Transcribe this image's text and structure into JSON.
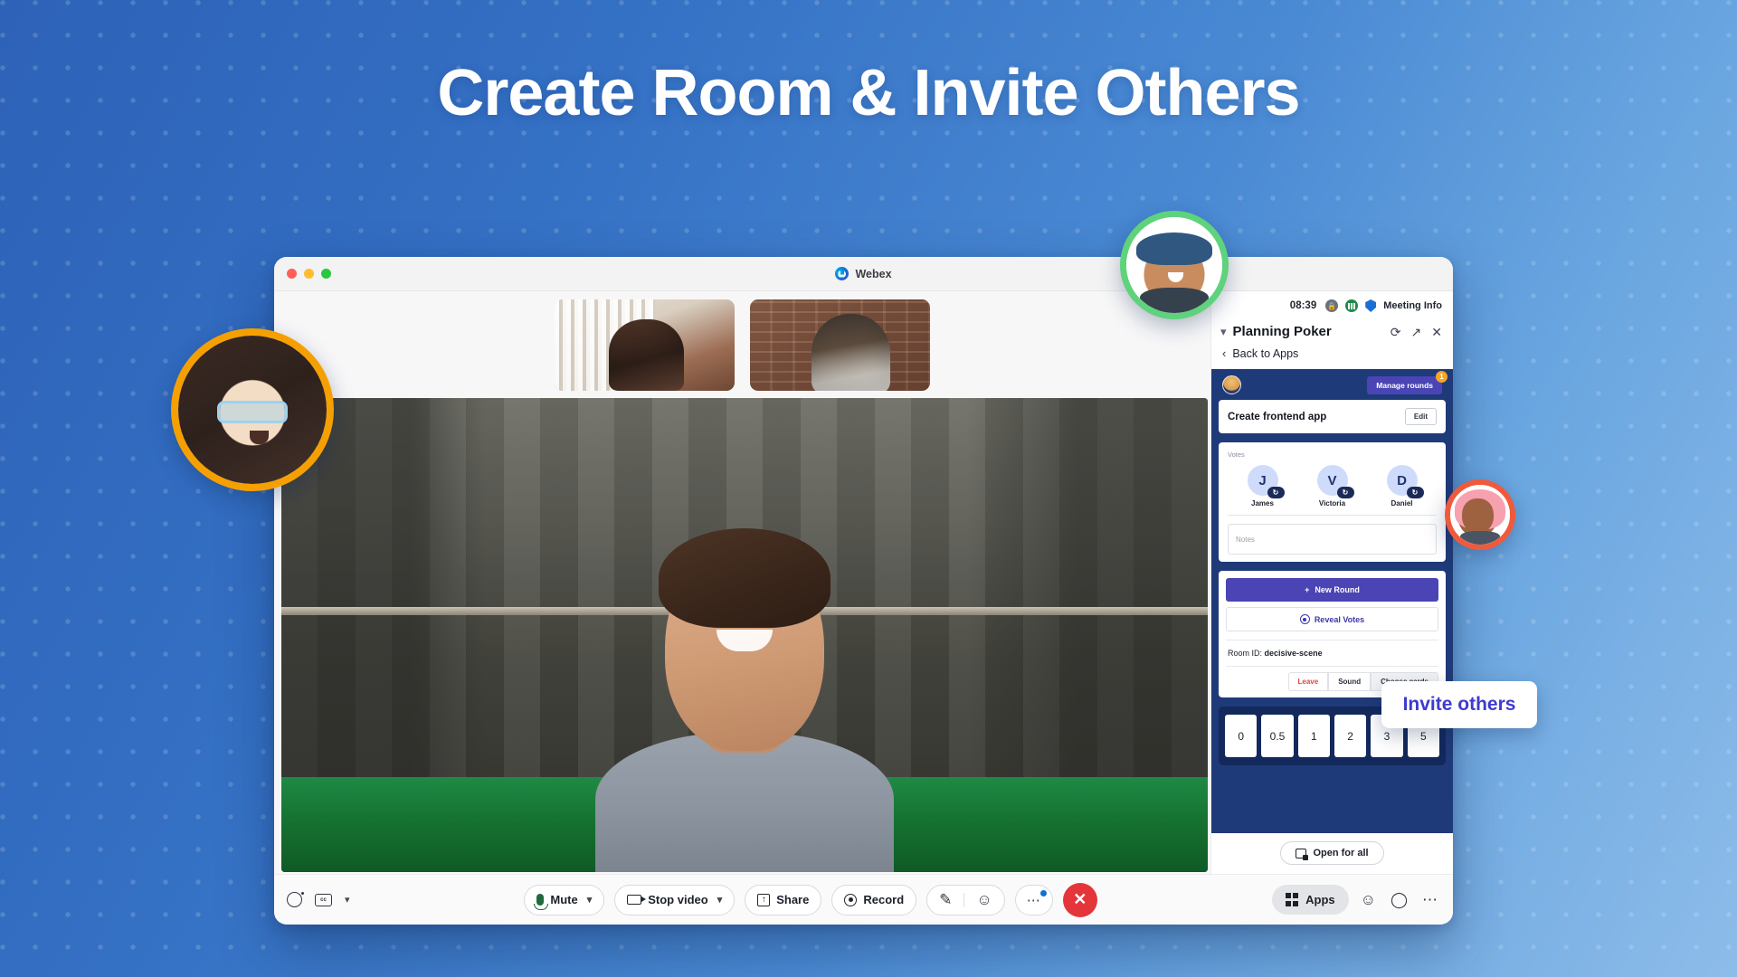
{
  "hero": {
    "title": "Create Room & Invite Others"
  },
  "window": {
    "app_name": "Webex",
    "traffic_lights": [
      "close-red",
      "minimize-yellow",
      "maximize-green"
    ]
  },
  "meeting_info": {
    "time": "08:39",
    "lock_icon": "lock-icon",
    "network_icon": "network-quality-icon",
    "shield_icon": "shield-icon",
    "label": "Meeting Info"
  },
  "panel": {
    "title": "Planning Poker",
    "collapse_icon": "chevron-down-icon",
    "refresh_icon": "refresh-icon",
    "popout_icon": "open-external-icon",
    "close_icon": "close-icon",
    "back_label": "Back to Apps",
    "back_icon": "chevron-left-icon"
  },
  "poker": {
    "avatar_icon": "user-avatar-icon",
    "manage_rounds_label": "Manage rounds",
    "manage_rounds_badge": "1",
    "topic": "Create frontend app",
    "edit_label": "Edit",
    "votes_label": "Votes",
    "voters": [
      {
        "initial": "J",
        "name": "James",
        "badge_icon": "pending-icon"
      },
      {
        "initial": "V",
        "name": "Victoria",
        "badge_icon": "pending-icon"
      },
      {
        "initial": "D",
        "name": "Daniel",
        "badge_icon": "pending-icon"
      }
    ],
    "notes_placeholder": "Notes",
    "new_round_label": "New Round",
    "new_round_icon": "plus-icon",
    "reveal_votes_label": "Reveal Votes",
    "reveal_icon": "eye-icon",
    "room_id_prefix": "Room ID:",
    "room_id": "decisive-scene",
    "leave_label": "Leave",
    "sound_label": "Sound",
    "choose_cards_label": "Choose cards",
    "deck": [
      "0",
      "0.5",
      "1",
      "2",
      "3",
      "5"
    ],
    "open_for_all_label": "Open for all",
    "open_for_all_icon": "open-for-all-icon"
  },
  "tooltip": {
    "label": "Invite others"
  },
  "controls": {
    "record_ring_icon": "recording-status-icon",
    "cc_icon": "closed-captions-icon",
    "cc_text": "cc",
    "cc_caret_icon": "chevron-down-icon",
    "mute_label": "Mute",
    "mute_icon": "microphone-icon",
    "mute_caret_icon": "chevron-down-icon",
    "video_label": "Stop video",
    "video_icon": "camera-icon",
    "video_caret_icon": "chevron-down-icon",
    "share_label": "Share",
    "share_icon": "share-screen-icon",
    "record_label": "Record",
    "record_icon": "record-icon",
    "annotate_icon": "annotate-icon",
    "reactions_icon": "reactions-icon",
    "more_icon": "more-options-icon",
    "end_icon": "end-call-icon",
    "apps_label": "Apps",
    "apps_icon": "apps-grid-icon",
    "participants_icon": "participants-icon",
    "chat_icon": "chat-icon",
    "rail_more_icon": "more-options-icon"
  },
  "floating_avatars": [
    {
      "name": "avatar-woman-sunglasses",
      "ring_color": "#f5a000"
    },
    {
      "name": "avatar-man-hat",
      "ring_color": "#5fd27c"
    },
    {
      "name": "avatar-woman-pink-hair",
      "ring_color": "#f05a3c"
    }
  ],
  "colors": {
    "background_top": "#2d62b8",
    "background_bottom": "#8dbce9",
    "poker_panel": "#1f3a78",
    "accent_purple": "#4a44b5",
    "end_call_red": "#e4353a",
    "tooltip_text": "#3f3ad0"
  }
}
